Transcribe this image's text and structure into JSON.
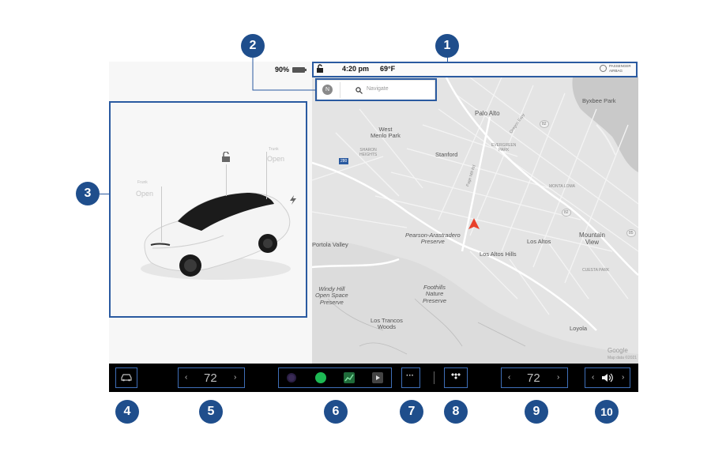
{
  "status_bar": {
    "battery_percent": "90%",
    "time": "4:20 pm",
    "temperature": "69°F",
    "airbag_line1": "PASSENGER",
    "airbag_line2": "AIRBAG"
  },
  "nav": {
    "search_placeholder": "Navigate",
    "compass_label": "N"
  },
  "car_panel": {
    "front_trunk_title": "Frunk",
    "front_trunk_state": "Open",
    "trunk_title": "Trunk",
    "trunk_state": "Open"
  },
  "map": {
    "labels": {
      "byxbee_park": "Byxbee Park",
      "palo_alto": "Palo Alto",
      "west_menlo_park": "West\nMenlo Park",
      "sharon_heights": "SHARON\nHEIGHTS",
      "stanford": "Stanford",
      "evergreen_park": "EVERGREEN\nPARK",
      "oregon_expy": "Oregon Expy",
      "page_mill_rd": "Page Mill Rd",
      "monta_loma": "MONTA LOMA",
      "pearson": "Pearson-Arastradero\nPreserve",
      "los_altos": "Los Altos",
      "mountain_view": "Mountain\nView",
      "portola_valley": "Portola Valley",
      "los_altos_hills": "Los Altos Hills",
      "cuesta_park": "CUESTA PARK",
      "windy_hill": "Windy Hill\nOpen Space\nPreserve",
      "foothills": "Foothills\nNature\nPreserve",
      "los_trancos": "Los Trancos\nWoods",
      "loyola": "Loyola",
      "google": "Google",
      "map_data": "Map data ©2021",
      "shield_280": "280",
      "shield_82_a": "82",
      "shield_82_b": "82",
      "shield_85": "85"
    }
  },
  "taskbar": {
    "driver_temp": "72",
    "passenger_temp": "72",
    "chev_left": "‹",
    "chev_right": "›",
    "more_label": "···"
  },
  "callouts": [
    "1",
    "2",
    "3",
    "4",
    "5",
    "6",
    "7",
    "8",
    "9",
    "10"
  ],
  "colors": {
    "callout_blue": "#1f4e8c",
    "highlight_blue": "#2a5aa0",
    "spotify_green": "#1db954",
    "position_red": "#e8402a"
  }
}
